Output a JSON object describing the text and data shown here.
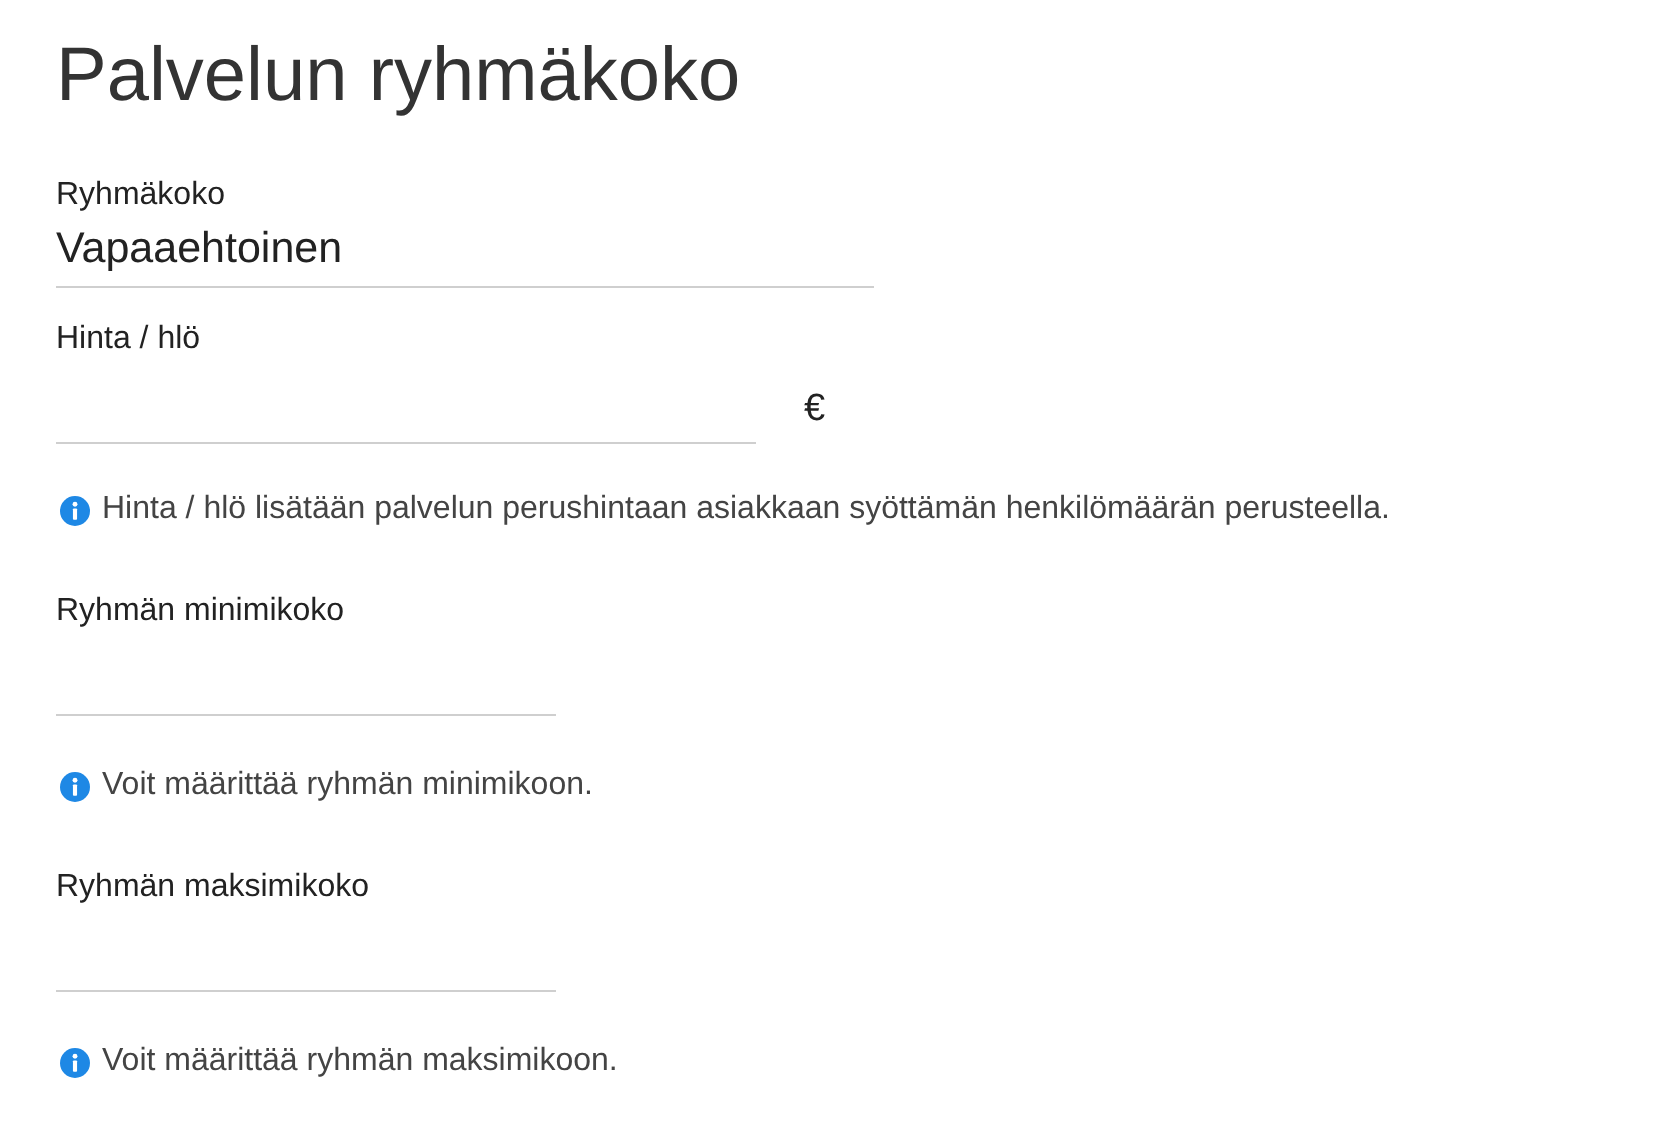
{
  "heading": "Palvelun ryhmäkoko",
  "fields": [
    {
      "kind": "select",
      "label": "Ryhmäkoko",
      "value": "Vapaaehtoinen"
    },
    {
      "kind": "price",
      "label": "Hinta / hlö",
      "unit": "€",
      "hint": "Hinta / hlö lisätään palvelun perushintaan asiakkaan syöttämän henkilömäärän perusteella."
    },
    {
      "kind": "number",
      "label": "Ryhmän minimikoko",
      "hint": "Voit määrittää ryhmän minimikoon."
    },
    {
      "kind": "number",
      "label": "Ryhmän maksimikoko",
      "hint": "Voit määrittää ryhmän maksimikoon."
    }
  ]
}
